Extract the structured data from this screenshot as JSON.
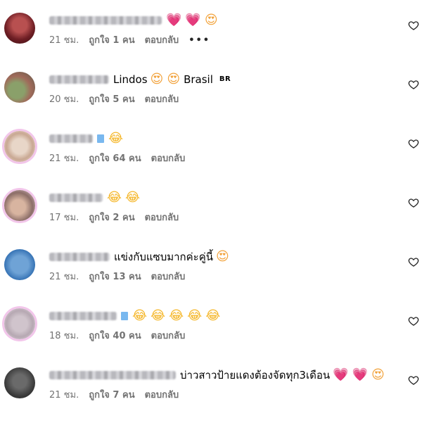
{
  "colors": {
    "meta_text": "#737373",
    "heart": "#f0376e"
  },
  "comments": [
    {
      "avatar": "blurred-avatar-1",
      "text": "",
      "emojis": [
        "💗",
        "💗",
        "😍"
      ],
      "meta": {
        "time": "21 ชม.",
        "likes": "ถูกใจ 1 คน",
        "reply": "ตอบกลับ",
        "more": "•••"
      }
    },
    {
      "avatar": "blurred-avatar-2",
      "text": "Lindos",
      "emojis": [
        "😍",
        "😍"
      ],
      "text2": "Brasil",
      "flag": "BR",
      "meta": {
        "time": "20 ชม.",
        "likes": "ถูกใจ 5 คน",
        "reply": "ตอบกลับ"
      }
    },
    {
      "avatar": "blurred-avatar-3",
      "text": "",
      "emojis": [
        "😂"
      ],
      "meta": {
        "time": "21 ชม.",
        "likes": "ถูกใจ 64 คน",
        "reply": "ตอบกลับ"
      }
    },
    {
      "avatar": "blurred-avatar-4",
      "text": "",
      "emojis": [
        "😂",
        "😂"
      ],
      "meta": {
        "time": "17 ชม.",
        "likes": "ถูกใจ 2 คน",
        "reply": "ตอบกลับ"
      }
    },
    {
      "avatar": "blurred-avatar-5",
      "text": "แข่งกับแซบมากค่ะคู่นี้",
      "emojis": [
        "😍"
      ],
      "meta": {
        "time": "21 ชม.",
        "likes": "ถูกใจ 13 คน",
        "reply": "ตอบกลับ"
      }
    },
    {
      "avatar": "blurred-avatar-6",
      "text": "",
      "emojis": [
        "😂",
        "😂",
        "😂",
        "😂",
        "😂"
      ],
      "meta": {
        "time": "18 ชม.",
        "likes": "ถูกใจ 40 คน",
        "reply": "ตอบกลับ"
      }
    },
    {
      "avatar": "blurred-avatar-7",
      "text": "บ่าวสาวป้ายแดงต้องจัดทุก3เดือน",
      "emojis": [
        "💗",
        "💗",
        "😍"
      ],
      "meta": {
        "time": "21 ชม.",
        "likes": "ถูกใจ 7 คน",
        "reply": "ตอบกลับ"
      }
    }
  ]
}
